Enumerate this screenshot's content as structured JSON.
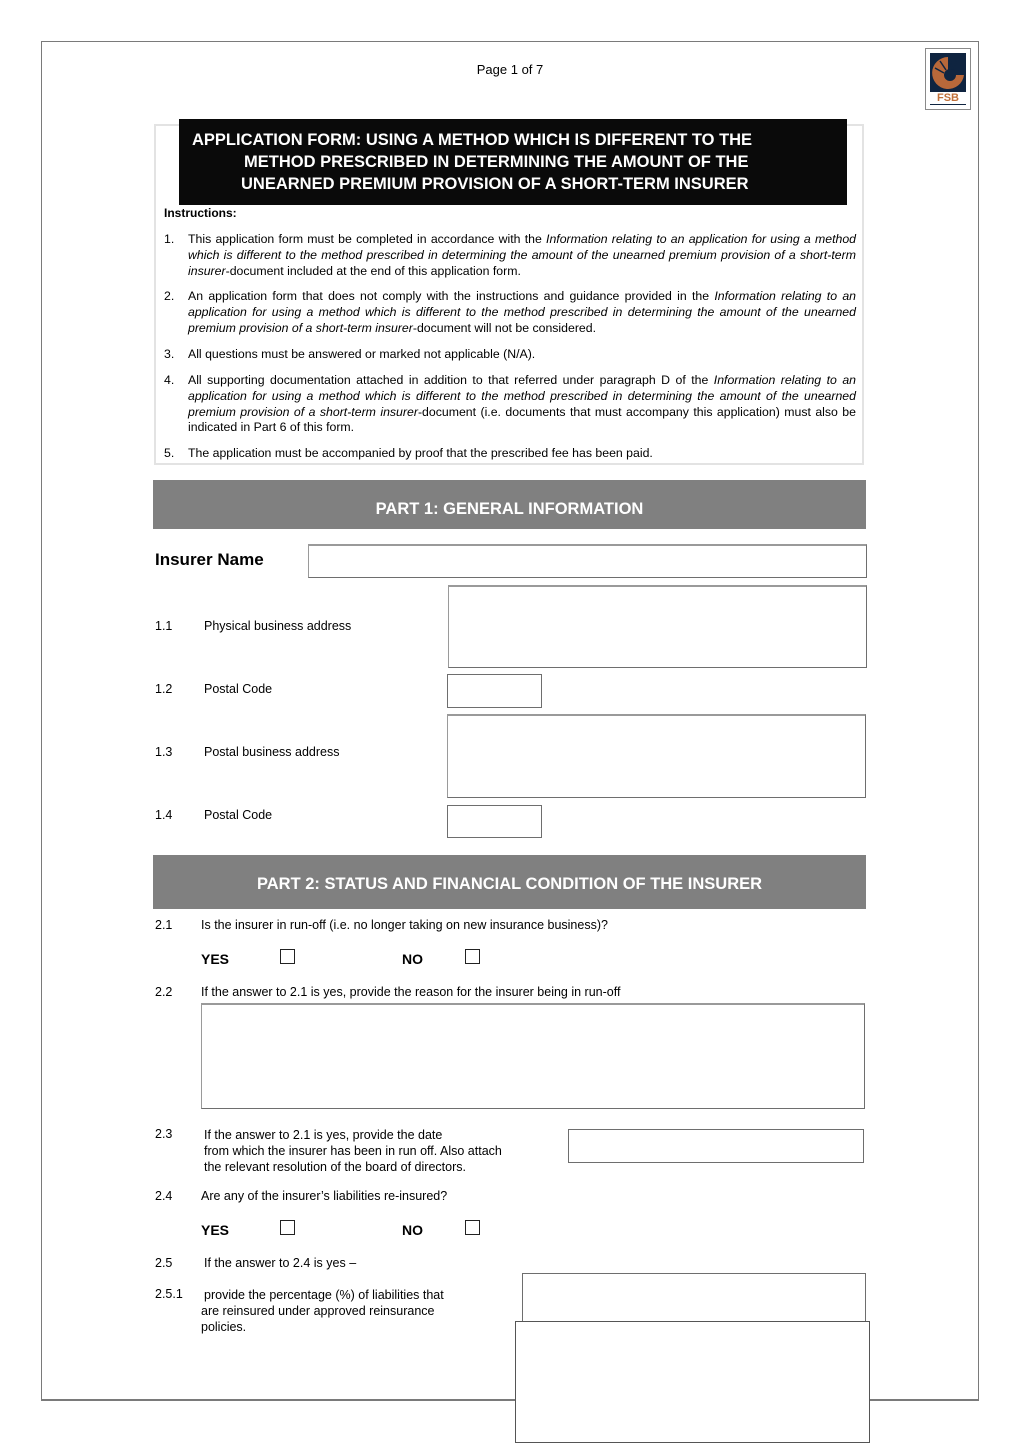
{
  "header": {
    "page_indicator": "Page 1 of 7",
    "logo_text": "FSB",
    "logo_icon": "fsb-logo-icon"
  },
  "title": {
    "lines": [
      "APPLICATION FORM: USING A METHOD WHICH IS DIFFERENT TO THE",
      "METHOD PRESCRIBED IN DETERMINING THE AMOUNT OF THE",
      "UNEARNED PREMIUM PROVISION OF A SHORT-TERM INSURER"
    ]
  },
  "instructions": {
    "label": "Instructions:",
    "items": [
      {
        "num": "1.",
        "pre": "This application form must be completed in accordance with the ",
        "italic": "Information relating to an application for using a    method which is different to the method prescribed in determining the amount of the unearned premium provision of a short-term insurer",
        "post": "-document included at the end of this application form."
      },
      {
        "num": "2.",
        "pre": "An application form that does not comply with the instructions and guidance provided in the ",
        "italic": "Information relating to an application for using a method which is different to the method prescribed in determining the amount of the unearned premium provision of a short-term insurer",
        "post": "-document will not be considered."
      },
      {
        "num": "3.",
        "pre": "All questions must be answered or marked not applicable (N/A).",
        "italic": "",
        "post": ""
      },
      {
        "num": "4.",
        "pre": "All supporting documentation attached in addition to that referred under paragraph D of the ",
        "italic": "Information relating to an application for using a method which is different to the method prescribed in determining the amount of the unearned premium provision of a short-term insurer",
        "post": "-document (i.e. documents that must accompany this application) must also be indicated in Part 6 of this form."
      },
      {
        "num": "5.",
        "pre": "The application must be accompanied by proof that the prescribed fee has been paid.",
        "italic": "",
        "post": ""
      }
    ]
  },
  "part1": {
    "heading": "PART 1: GENERAL INFORMATION",
    "insurer_name_label": "Insurer Name",
    "insurer_name_value": "",
    "questions": [
      {
        "num": "1.1",
        "label": "Physical business address",
        "value": ""
      },
      {
        "num": "1.2",
        "label": "Postal Code",
        "value": ""
      },
      {
        "num": "1.3",
        "label": "Postal business address",
        "value": ""
      },
      {
        "num": "1.4",
        "label": "Postal Code",
        "value": ""
      }
    ]
  },
  "part2": {
    "heading": "PART 2: STATUS AND FINANCIAL CONDITION OF THE INSURER",
    "q2_1": {
      "num": "2.1",
      "text": "Is the insurer in run-off (i.e. no longer taking on new insurance business)?",
      "yes_label": "YES",
      "no_label": "NO",
      "yes_checked": false,
      "no_checked": false
    },
    "q2_2": {
      "num": "2.2",
      "text": "If the answer to 2.1 is yes, provide the reason for the insurer being in run-off",
      "value": ""
    },
    "q2_3": {
      "num": "2.3",
      "lines": [
        "If the answer to 2.1 is yes, provide the date",
        "from which the insurer has been in run off. Also attach",
        "the relevant resolution of the board of directors."
      ],
      "value": ""
    },
    "q2_4": {
      "num": "2.4",
      "text": "Are any of the insurer’s liabilities re-insured?",
      "yes_label": "YES",
      "no_label": "NO",
      "yes_checked": false,
      "no_checked": false
    },
    "q2_5": {
      "num": "2.5",
      "text": "If the answer to 2.4 is yes –"
    },
    "q2_5_1": {
      "num": "2.5.1",
      "lines": [
        "provide the percentage (%) of liabilities that",
        "are reinsured under approved reinsurance",
        "policies."
      ],
      "value": ""
    }
  }
}
